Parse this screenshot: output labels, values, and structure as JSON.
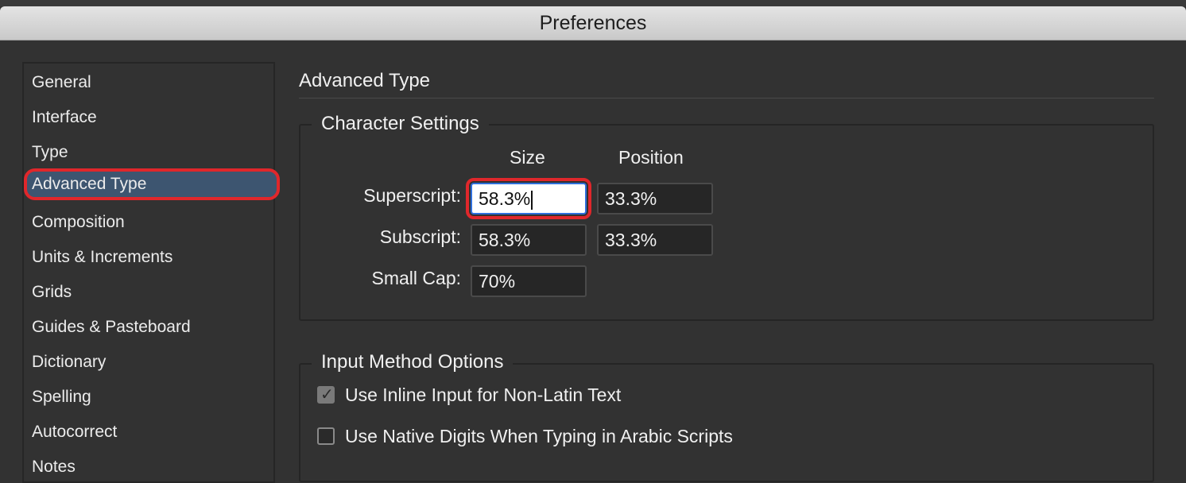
{
  "window": {
    "title": "Preferences"
  },
  "sidebar": {
    "items": [
      {
        "label": "General"
      },
      {
        "label": "Interface"
      },
      {
        "label": "Type"
      },
      {
        "label": "Advanced Type",
        "selected": true
      },
      {
        "label": "Composition"
      },
      {
        "label": "Units & Increments"
      },
      {
        "label": "Grids"
      },
      {
        "label": "Guides & Pasteboard"
      },
      {
        "label": "Dictionary"
      },
      {
        "label": "Spelling"
      },
      {
        "label": "Autocorrect"
      },
      {
        "label": "Notes"
      }
    ]
  },
  "main": {
    "title": "Advanced Type",
    "character_settings": {
      "legend": "Character Settings",
      "col_size": "Size",
      "col_position": "Position",
      "rows": [
        {
          "label": "Superscript:",
          "size": "58.3%",
          "position": "33.3%"
        },
        {
          "label": "Subscript:",
          "size": "58.3%",
          "position": "33.3%"
        },
        {
          "label": "Small Cap:",
          "size": "70%"
        }
      ]
    },
    "input_method": {
      "legend": "Input Method Options",
      "options": [
        {
          "label": "Use Inline Input for Non-Latin Text",
          "checked": true
        },
        {
          "label": "Use Native Digits When Typing in Arabic Scripts",
          "checked": false
        }
      ]
    }
  },
  "colors": {
    "background": "#323232",
    "selection": "#3d5570",
    "highlight": "#e0272b",
    "focus": "#2f6fdc"
  }
}
